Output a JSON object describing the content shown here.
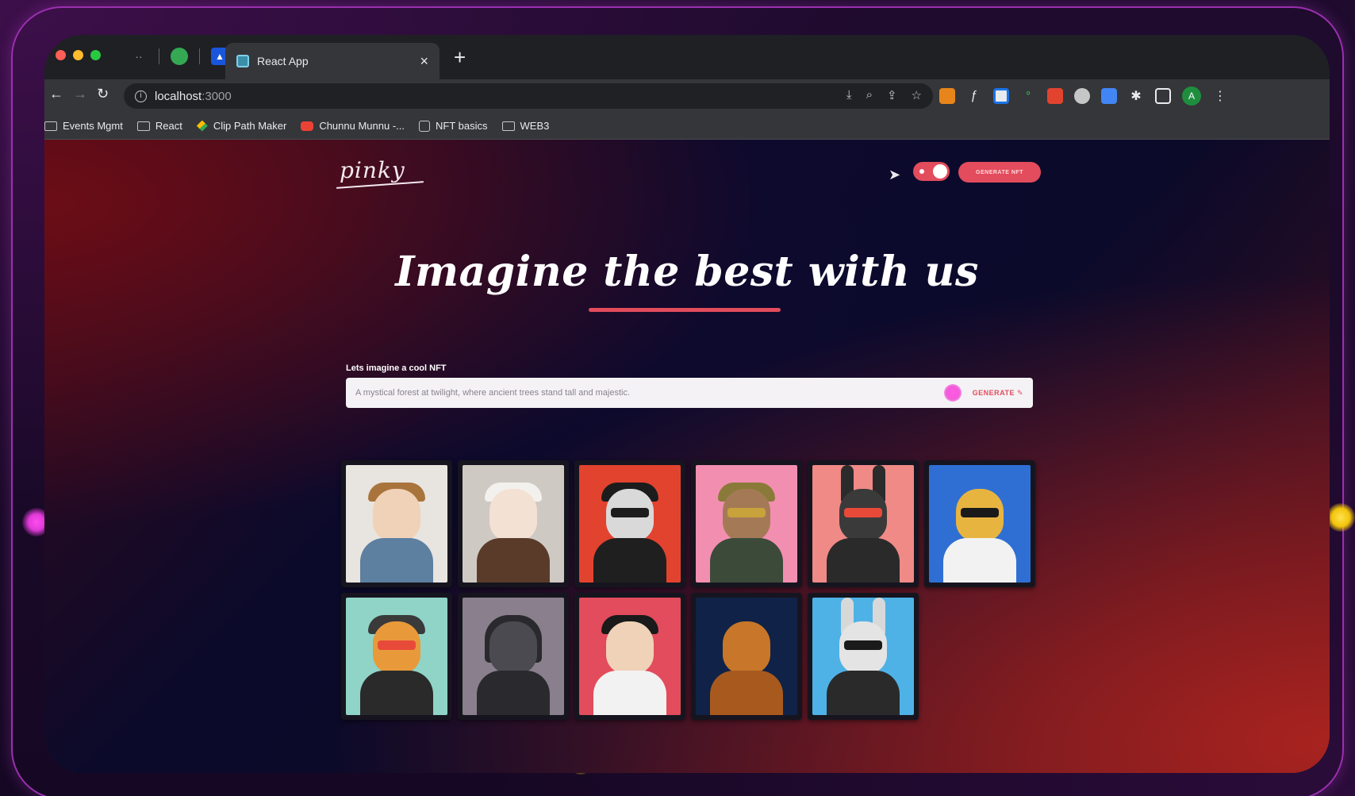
{
  "browser": {
    "tab_title": "React App",
    "tab_close": "×",
    "new_tab": "+",
    "url_host": "localhost",
    "url_port": ":3000",
    "bookmarks": [
      {
        "label": "Events Mgmt",
        "icon": "folder-icon"
      },
      {
        "label": "React",
        "icon": "folder-icon"
      },
      {
        "label": "Clip Path Maker",
        "icon": "clip-path-icon"
      },
      {
        "label": "Chunnu Munnu -...",
        "icon": "youtube-icon"
      },
      {
        "label": "NFT basics",
        "icon": "bookmark-page-icon"
      },
      {
        "label": "WEB3",
        "icon": "folder-icon"
      }
    ],
    "profile_initial": "A"
  },
  "app": {
    "logo": "pinky",
    "generate_nft_button": "GENERATE NFT",
    "hero_title": "Imagine the best with us",
    "input_label": "Lets imagine a cool NFT",
    "prompt_value": "A mystical forest at twilight, where ancient trees stand tall and majestic.",
    "prompt_generate": "GENERATE"
  },
  "colors": {
    "accent": "#e24c5c",
    "frame_border": "#9b2fb0"
  },
  "nfts": [
    {
      "name": "nft-boy-cigarette",
      "bg": "#e8e4df"
    },
    {
      "name": "nft-girl-white-hair",
      "bg": "#cfc9c4"
    },
    {
      "name": "nft-masked-bitcoin",
      "bg": "#e2432f"
    },
    {
      "name": "nft-tribal-warrior",
      "bg": "#f28fb0"
    },
    {
      "name": "nft-rabbit-pizza",
      "bg": "#ef8a86"
    },
    {
      "name": "nft-leopard-sunglasses",
      "bg": "#2f6fd4"
    },
    {
      "name": "nft-tiger-cap",
      "bg": "#8fd4c7"
    },
    {
      "name": "nft-hooded-mask",
      "bg": "#8a7f8c"
    },
    {
      "name": "nft-bearded-man",
      "bg": "#e24c5c"
    },
    {
      "name": "nft-ape-cigarette",
      "bg": "#102247"
    },
    {
      "name": "nft-rabbit-goggles",
      "bg": "#4eb2e6"
    }
  ]
}
